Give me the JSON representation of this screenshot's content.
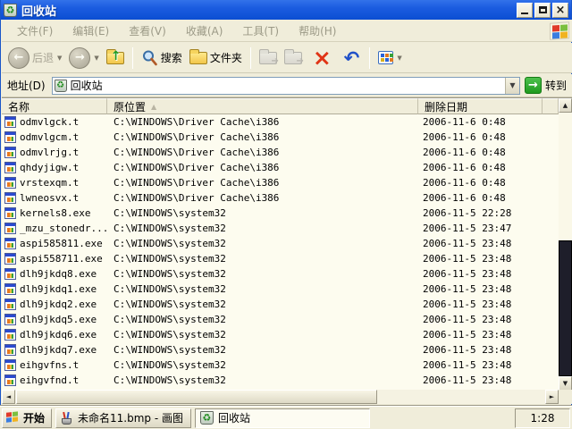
{
  "titlebar": {
    "title": "回收站"
  },
  "menubar": {
    "items": [
      "文件(F)",
      "编辑(E)",
      "查看(V)",
      "收藏(A)",
      "工具(T)",
      "帮助(H)"
    ]
  },
  "toolbar": {
    "back_label": "后退",
    "search_label": "搜索",
    "folders_label": "文件夹"
  },
  "addressbar": {
    "label": "地址(D)",
    "value": "回收站",
    "go_label": "转到"
  },
  "list": {
    "columns": {
      "name": "名称",
      "location": "原位置",
      "deleted": "删除日期"
    },
    "sort_column": "原位置",
    "rows": [
      {
        "name": "odmvlgck.t",
        "location": "C:\\WINDOWS\\Driver Cache\\i386",
        "deleted": "2006-11-6 0:48"
      },
      {
        "name": "odmvlgcm.t",
        "location": "C:\\WINDOWS\\Driver Cache\\i386",
        "deleted": "2006-11-6 0:48"
      },
      {
        "name": "odmvlrjg.t",
        "location": "C:\\WINDOWS\\Driver Cache\\i386",
        "deleted": "2006-11-6 0:48"
      },
      {
        "name": "qhdyjigw.t",
        "location": "C:\\WINDOWS\\Driver Cache\\i386",
        "deleted": "2006-11-6 0:48"
      },
      {
        "name": "vrstexqm.t",
        "location": "C:\\WINDOWS\\Driver Cache\\i386",
        "deleted": "2006-11-6 0:48"
      },
      {
        "name": "lwneosvx.t",
        "location": "C:\\WINDOWS\\Driver Cache\\i386",
        "deleted": "2006-11-6 0:48"
      },
      {
        "name": "kernels8.exe",
        "location": "C:\\WINDOWS\\system32",
        "deleted": "2006-11-5 22:28"
      },
      {
        "name": "_mzu_stonedr...",
        "location": "C:\\WINDOWS\\system32",
        "deleted": "2006-11-5 23:47"
      },
      {
        "name": "aspi585811.exe",
        "location": "C:\\WINDOWS\\system32",
        "deleted": "2006-11-5 23:48"
      },
      {
        "name": "aspi558711.exe",
        "location": "C:\\WINDOWS\\system32",
        "deleted": "2006-11-5 23:48"
      },
      {
        "name": "dlh9jkdq8.exe",
        "location": "C:\\WINDOWS\\system32",
        "deleted": "2006-11-5 23:48"
      },
      {
        "name": "dlh9jkdq1.exe",
        "location": "C:\\WINDOWS\\system32",
        "deleted": "2006-11-5 23:48"
      },
      {
        "name": "dlh9jkdq2.exe",
        "location": "C:\\WINDOWS\\system32",
        "deleted": "2006-11-5 23:48"
      },
      {
        "name": "dlh9jkdq5.exe",
        "location": "C:\\WINDOWS\\system32",
        "deleted": "2006-11-5 23:48"
      },
      {
        "name": "dlh9jkdq6.exe",
        "location": "C:\\WINDOWS\\system32",
        "deleted": "2006-11-5 23:48"
      },
      {
        "name": "dlh9jkdq7.exe",
        "location": "C:\\WINDOWS\\system32",
        "deleted": "2006-11-5 23:48"
      },
      {
        "name": "eihgvfns.t",
        "location": "C:\\WINDOWS\\system32",
        "deleted": "2006-11-5 23:48"
      },
      {
        "name": "eihgvfnd.t",
        "location": "C:\\WINDOWS\\system32",
        "deleted": "2006-11-5 23:48"
      }
    ]
  },
  "taskbar": {
    "start_label": "开始",
    "tasks": [
      {
        "label": "未命名11.bmp - 画图"
      },
      {
        "label": "回收站"
      }
    ],
    "clock": "1:28"
  },
  "icons": {
    "recycle": "♻",
    "close": "×",
    "back_arrow": "←",
    "forward_arrow": "→",
    "up_arrow": "↑",
    "dropdown": "▼",
    "undo": "↶",
    "delete_x": "×",
    "go_arrow": "→",
    "sort_asc": "▲",
    "scroll_up": "▲",
    "scroll_down": "▼",
    "scroll_left": "◄",
    "scroll_right": "►",
    "disabled_arrow": "➔"
  },
  "colors": {
    "titlebar_blue": "#0b4ed2",
    "go_green": "#1f9a1f",
    "delete_red": "#e03415",
    "undo_blue": "#2050c8"
  }
}
